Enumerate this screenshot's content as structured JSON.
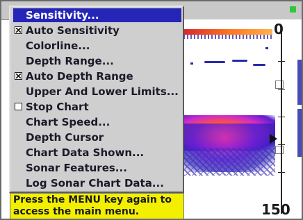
{
  "menu": {
    "items": [
      {
        "label": "Sensitivity...",
        "selected": true,
        "checkbox": null
      },
      {
        "label": "Auto Sensitivity",
        "selected": false,
        "checkbox": "checked"
      },
      {
        "label": "Colorline...",
        "selected": false,
        "checkbox": null
      },
      {
        "label": "Depth Range...",
        "selected": false,
        "checkbox": null
      },
      {
        "label": "Auto Depth Range",
        "selected": false,
        "checkbox": "checked"
      },
      {
        "label": "Upper And Lower Limits...",
        "selected": false,
        "checkbox": null
      },
      {
        "label": "Stop Chart",
        "selected": false,
        "checkbox": "unchecked"
      },
      {
        "label": "Chart Speed...",
        "selected": false,
        "checkbox": null
      },
      {
        "label": "Depth Cursor",
        "selected": false,
        "checkbox": null
      },
      {
        "label": "Chart Data Shown...",
        "selected": false,
        "checkbox": null
      },
      {
        "label": "Sonar Features...",
        "selected": false,
        "checkbox": null
      },
      {
        "label": "Log Sonar Chart Data...",
        "selected": false,
        "checkbox": null
      }
    ]
  },
  "hint": {
    "text": "Press the MENU key again to access the main menu."
  },
  "sonar": {
    "depth_scale_top": "0",
    "depth_scale_bottom": "150"
  },
  "colors": {
    "menu_background": "#cfcfcf",
    "selection": "#2525b8",
    "hint_background": "#f2f000",
    "status_led": "#2fc83a"
  }
}
